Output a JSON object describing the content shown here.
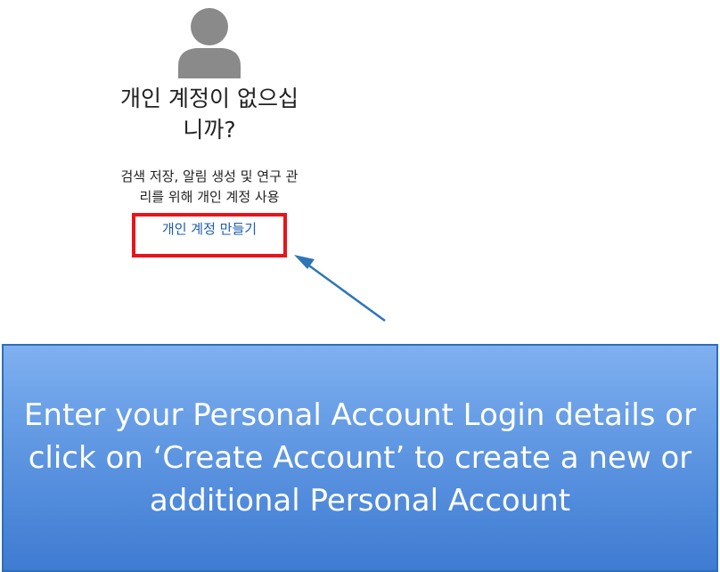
{
  "account_panel": {
    "avatar_icon": "user-silhouette-icon",
    "title_line1": "개인 계정이 없으십",
    "title_line2": "니까?",
    "description_line1": "검색 저장, 알림 생성 및 연구 관",
    "description_line2": "리를 위해 개인 계정 사용",
    "create_account_link": "개인 계정 만들기"
  },
  "annotation": {
    "highlight_color": "#e8141c",
    "arrow_color": "#2e75b6",
    "callout_text": "Enter your Personal Account Login details or click on ‘Create Account’ to create a new or additional Personal Account",
    "callout_color": "#5f97e2"
  }
}
